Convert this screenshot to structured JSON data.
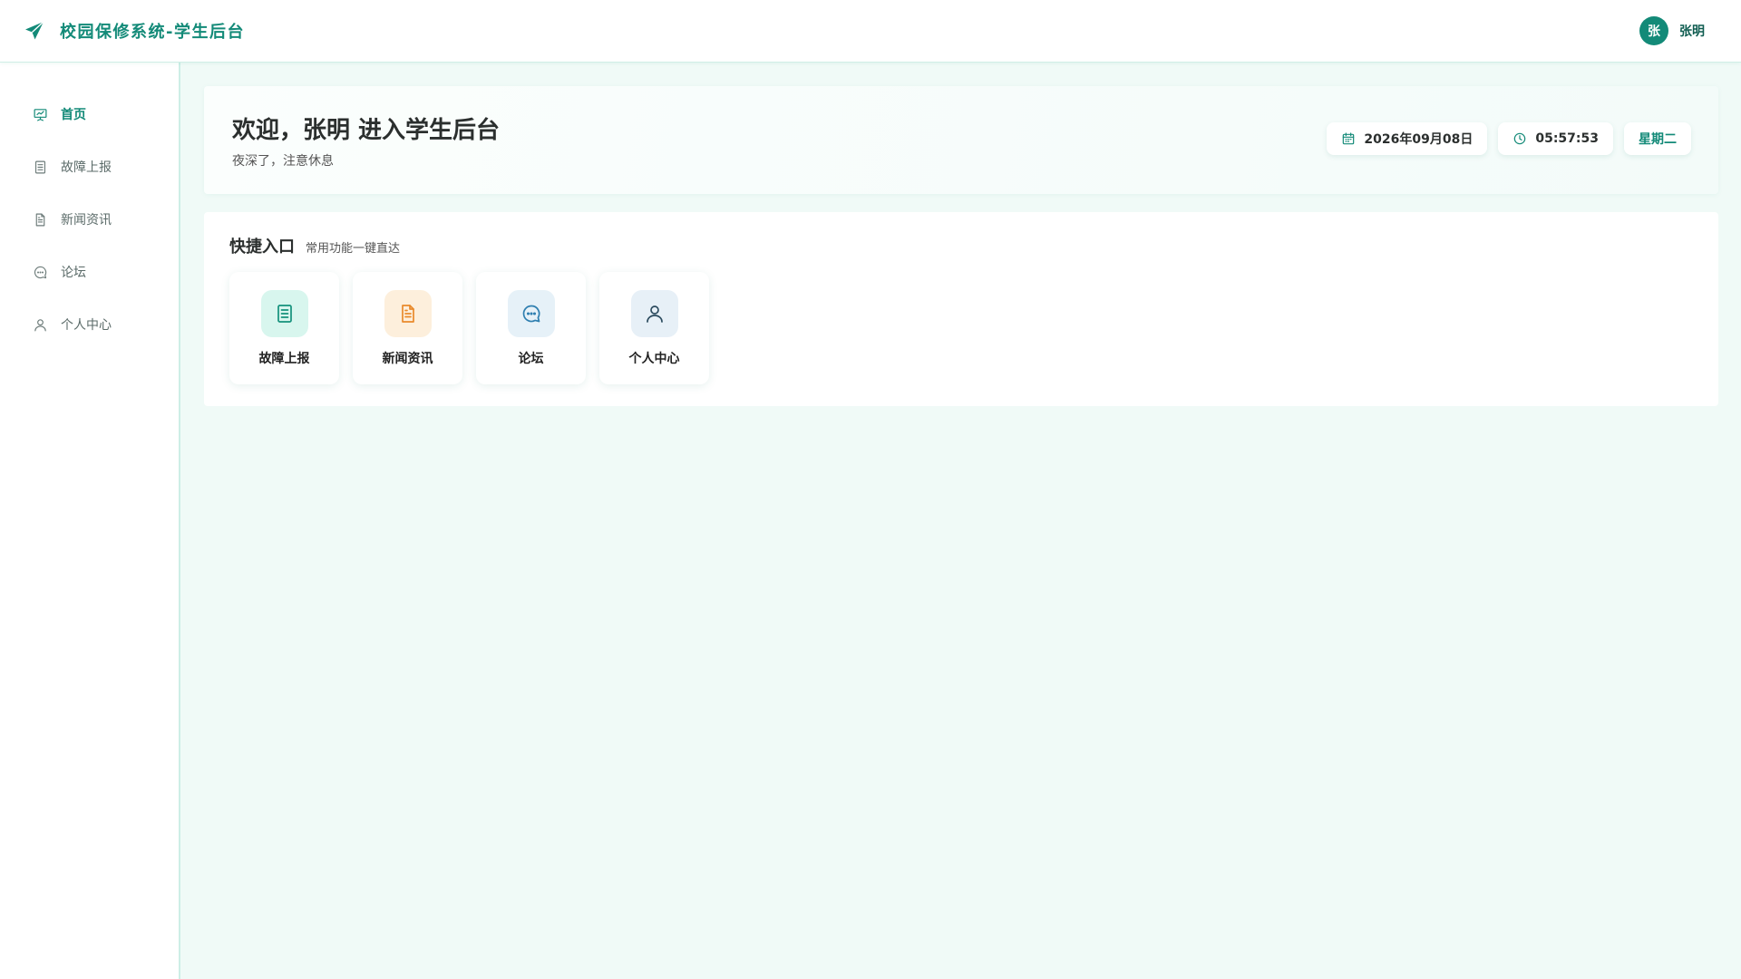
{
  "header": {
    "title": "校园保修系统-学生后台",
    "logo_icon": "paper-plane-icon",
    "user": {
      "avatar_text": "张",
      "name": "张明"
    }
  },
  "sidebar": {
    "items": [
      {
        "label": "首页",
        "icon": "presentation-chart-icon",
        "active": true
      },
      {
        "label": "故障上报",
        "icon": "document-list-icon",
        "active": false
      },
      {
        "label": "新闻资讯",
        "icon": "document-text-icon",
        "active": false
      },
      {
        "label": "论坛",
        "icon": "chat-bubble-icon",
        "active": false
      },
      {
        "label": "个人中心",
        "icon": "user-icon",
        "active": false
      }
    ]
  },
  "welcome": {
    "title": "欢迎，张明 进入学生后台",
    "subtitle": "夜深了，注意休息",
    "date": "2026年09月08日",
    "time": "05:57:53",
    "weekday": "星期二"
  },
  "quick": {
    "title": "快捷入口",
    "subtitle": "常用功能一键直达",
    "cards": [
      {
        "label": "故障上报",
        "icon": "document-list-icon"
      },
      {
        "label": "新闻资讯",
        "icon": "document-text-icon"
      },
      {
        "label": "论坛",
        "icon": "chat-bubble-icon"
      },
      {
        "label": "个人中心",
        "icon": "user-icon"
      }
    ]
  },
  "colors": {
    "brand": "#138a78",
    "background": "#f0faf7",
    "card_tint_1": "#d8f6ee",
    "card_tint_2": "#fdefdc",
    "card_tint_3": "#e6f1f8",
    "card_tint_4": "#e7f0f7"
  }
}
